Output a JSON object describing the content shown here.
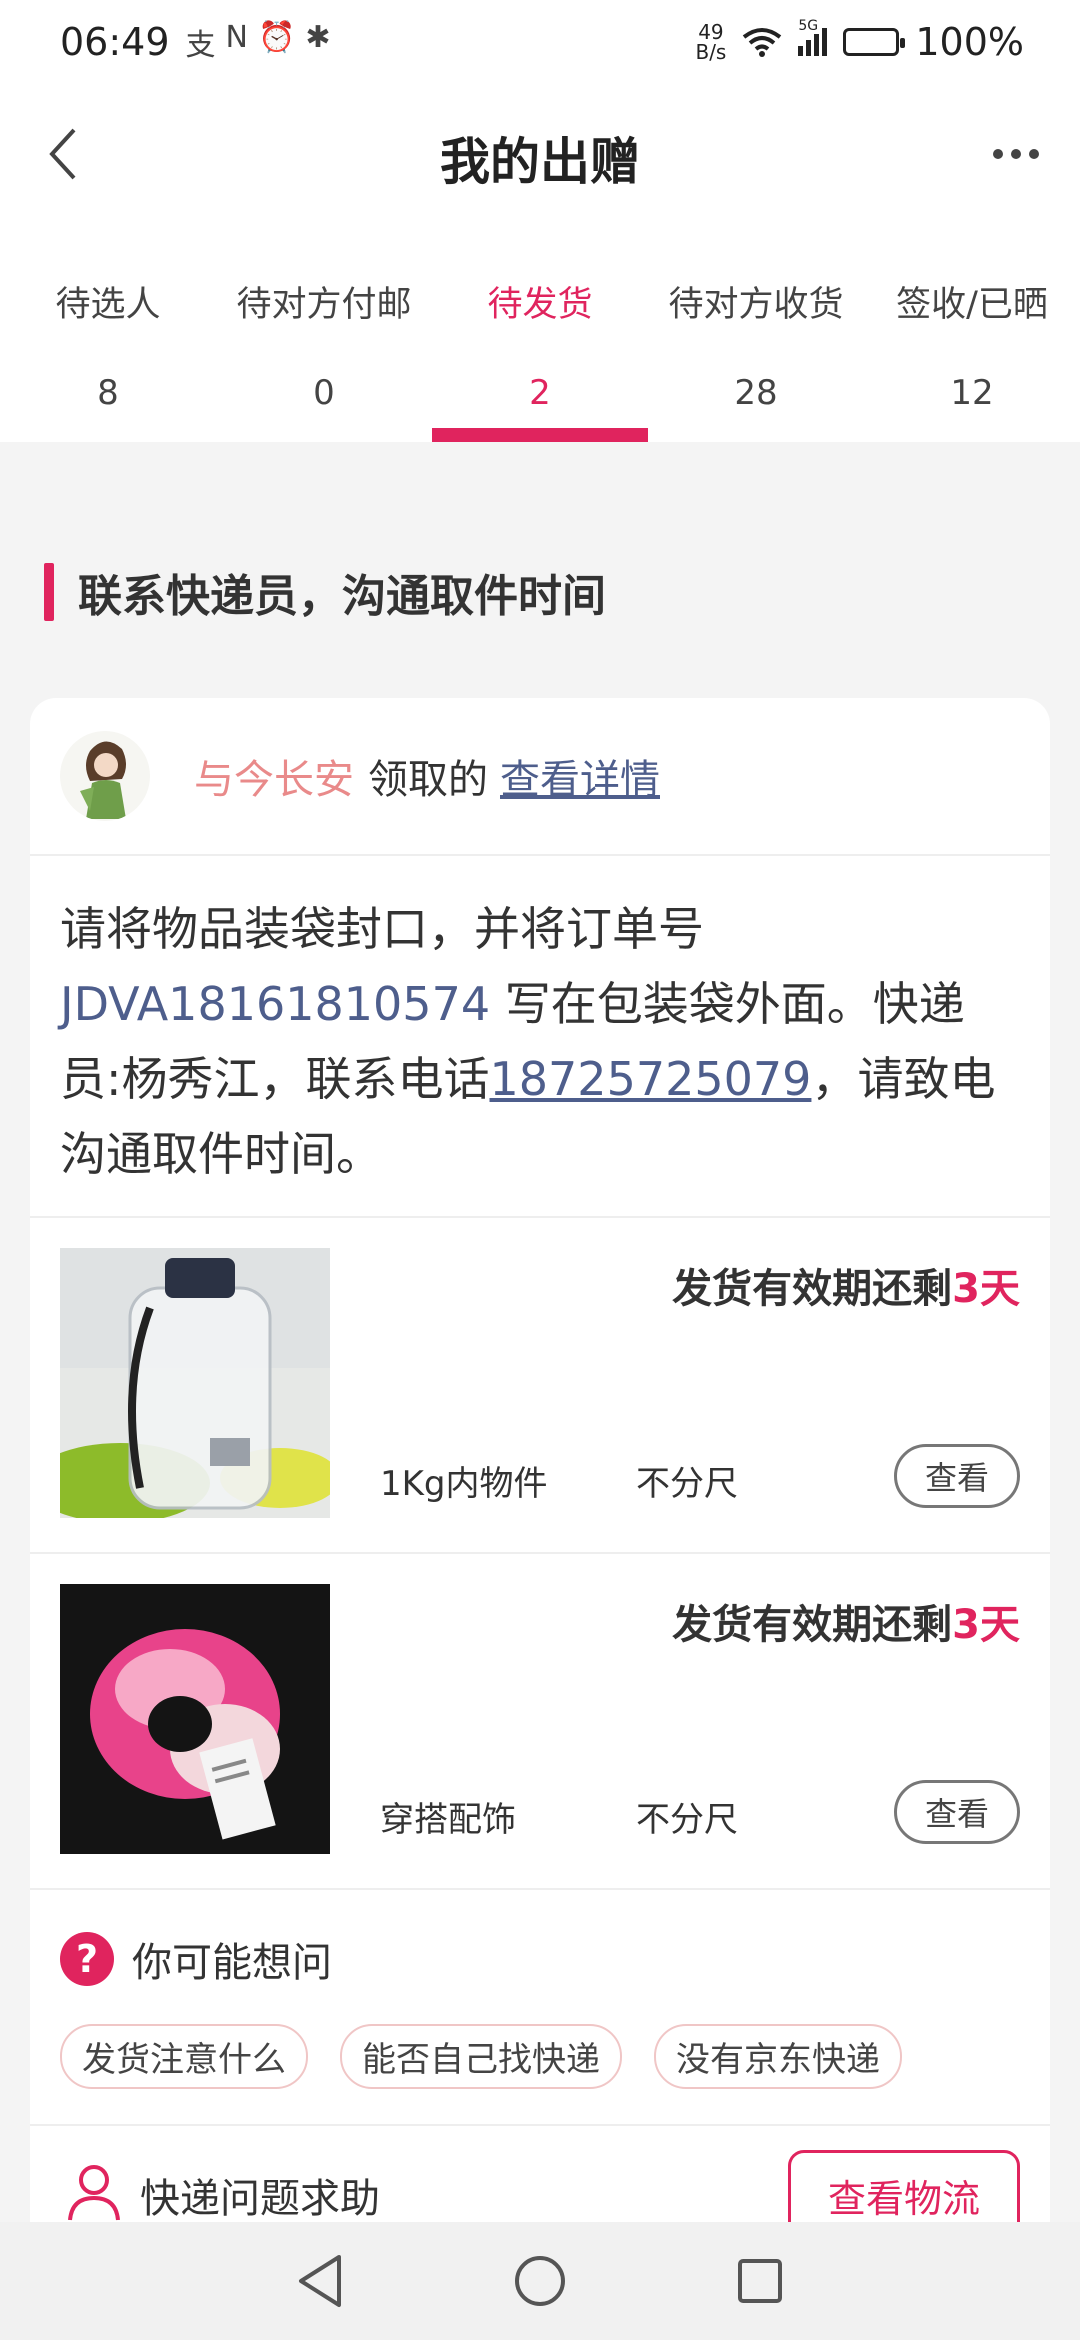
{
  "status_bar": {
    "time": "06:49",
    "left_icons": [
      "支",
      "N",
      "⏰",
      "✱"
    ],
    "net_speed_value": "49",
    "net_speed_unit": "B/s",
    "signal": "5G",
    "battery": "100%"
  },
  "header": {
    "title": "我的出赠"
  },
  "tabs": [
    {
      "label": "待选人",
      "count": "8"
    },
    {
      "label": "待对方付邮",
      "count": "0"
    },
    {
      "label": "待发货",
      "count": "2"
    },
    {
      "label": "待对方收货",
      "count": "28"
    },
    {
      "label": "签收/已晒",
      "count": "12"
    }
  ],
  "section": {
    "title": "联系快递员，沟通取件时间"
  },
  "claim": {
    "user": "与今长安",
    "middle": "领取的",
    "link": "查看详情"
  },
  "instructions": {
    "part1": "请将物品装袋封口，并将订单号 ",
    "order_no": "JDVA18161810574",
    "part2": " 写在包装袋外面。快递员:杨秀江，联系电话",
    "phone": "18725725079",
    "part3": "，请致电沟通取件时间。"
  },
  "items": [
    {
      "deadline_prefix": "发货有效期还剩",
      "deadline_days": "3天",
      "category": "1Kg内物件",
      "size": "不分尺",
      "view_label": "查看"
    },
    {
      "deadline_prefix": "发货有效期还剩",
      "deadline_days": "3天",
      "category": "穿搭配饰",
      "size": "不分尺",
      "view_label": "查看"
    }
  ],
  "faq": {
    "icon": "?",
    "title": "你可能想问",
    "chips": [
      "发货注意什么",
      "能否自己找快递",
      "没有京东快递"
    ]
  },
  "help": {
    "title": "快递问题求助",
    "button": "查看物流"
  },
  "colors": {
    "accent": "#e0245e",
    "link": "#4e5e8c",
    "claim_user": "#e98a8a"
  }
}
